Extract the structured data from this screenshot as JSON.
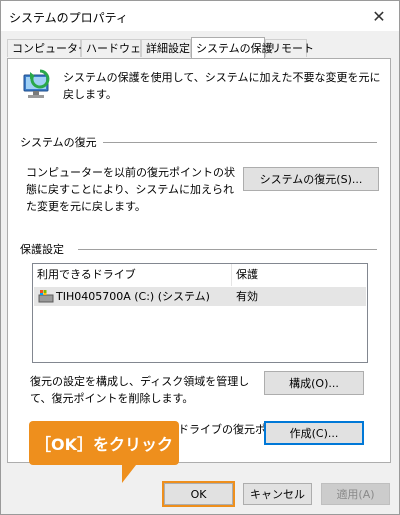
{
  "window": {
    "title": "システムのプロパティ",
    "close_glyph": "✕"
  },
  "tabs": [
    {
      "label": "コンピューター名",
      "active": false
    },
    {
      "label": "ハードウェア",
      "active": false
    },
    {
      "label": "詳細設定",
      "active": false
    },
    {
      "label": "システムの保護",
      "active": true
    },
    {
      "label": "リモート",
      "active": false
    }
  ],
  "intro": {
    "icon": "system-protection-icon",
    "text": "システムの保護を使用して、システムに加えた不要な変更を元に戻します。"
  },
  "restore": {
    "group_title": "システムの復元",
    "description": "コンピューターを以前の復元ポイントの状態に戻すことにより、システムに加えられた変更を元に戻します。",
    "button": "システムの復元(S)..."
  },
  "protection": {
    "group_title": "保護設定",
    "columns": [
      "利用できるドライブ",
      "保護"
    ],
    "rows": [
      {
        "drive": "TIH0405700A (C:) (システム)",
        "status": "有効",
        "icon": "drive-icon"
      }
    ],
    "configure_text": "復元の設定を構成し、ディスク領域を管理して、復元ポイントを削除します。",
    "configure_button": "構成(O)...",
    "create_text_visible": "ドライブの復元ポイ",
    "create_button": "作成(C)..."
  },
  "footer": {
    "ok": "OK",
    "cancel": "キャンセル",
    "apply": "適用(A)"
  },
  "annotation": {
    "callout_text": "［OK］をクリック",
    "color": "#ee8f1d"
  }
}
